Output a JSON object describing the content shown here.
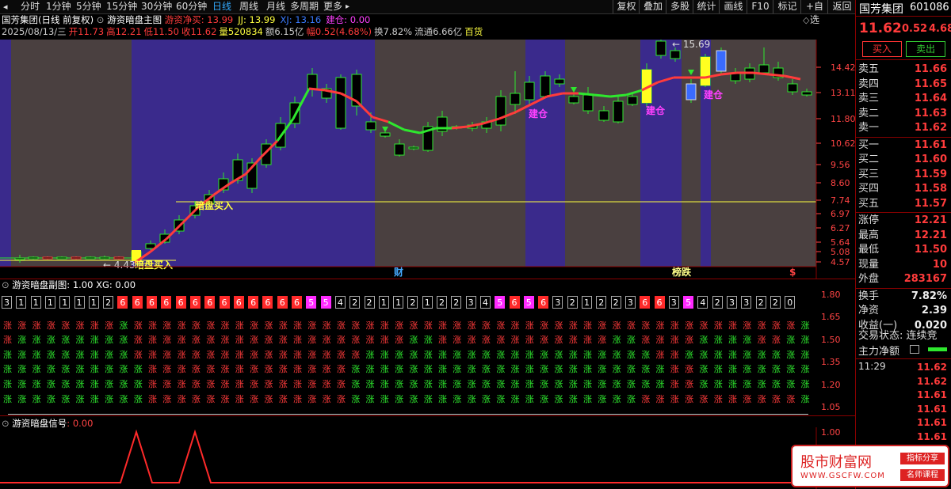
{
  "toolbar": {
    "tabs": [
      "分时",
      "1分钟",
      "5分钟",
      "15分钟",
      "30分钟",
      "60分钟",
      "日线",
      "周线",
      "月线",
      "多周期",
      "更多"
    ],
    "active": "日线",
    "right_buttons": [
      "复权",
      "叠加",
      "多股",
      "统计",
      "画线",
      "F10",
      "标记",
      "+自选",
      "返回"
    ]
  },
  "header": {
    "stock_name": "国芳集团",
    "mode": "(日线 前复权)",
    "indicator": "游资暗盘主图",
    "ind_vals": [
      {
        "label": "游资净买: 13.99",
        "color": "#ff3b3b"
      },
      {
        "label": "JJ: 13.99",
        "color": "#ffff40"
      },
      {
        "label": "XJ: 13.16",
        "color": "#3a7bff"
      },
      {
        "label": "建仓: 0.00",
        "color": "#ff40ff"
      }
    ],
    "line2": [
      {
        "t": "2025/08/13/三",
        "c": "#ccc"
      },
      {
        "t": "开11.73",
        "c": "#ff3b3b"
      },
      {
        "t": "高12.21",
        "c": "#ff3b3b"
      },
      {
        "t": "低11.50",
        "c": "#ff3b3b"
      },
      {
        "t": "收11.62",
        "c": "#ff3b3b"
      },
      {
        "t": "量520834",
        "c": "#ffff40"
      },
      {
        "t": "额6.15亿",
        "c": "#ccc"
      },
      {
        "t": "幅0.52(4.68%)",
        "c": "#ff3b3b"
      },
      {
        "t": "换7.82%",
        "c": "#ccc"
      },
      {
        "t": "流通6.66亿",
        "c": "#ccc"
      },
      {
        "t": "百货",
        "c": "#ffff40"
      }
    ]
  },
  "main_chart": {
    "annotations": [
      {
        "text": "暗盘买入",
        "color": "#ffff40"
      },
      {
        "text": "暗盘买入",
        "color": "#ffff40"
      },
      {
        "text": "建仓",
        "color": "#ff40ff"
      },
      {
        "text": "建仓",
        "color": "#ff40ff"
      },
      {
        "text": "建仓",
        "color": "#ff40ff"
      },
      {
        "text": "15.69",
        "color": "#ddd"
      },
      {
        "text": "4.43",
        "color": "#ddd"
      },
      {
        "text": "财",
        "color": "#4af"
      },
      {
        "text": "榜跌",
        "color": "#ff8"
      },
      {
        "text": "$",
        "color": "#f44"
      }
    ],
    "price_axis": [
      "14.42",
      "13.11",
      "11.80",
      "10.62",
      "9.56",
      "8.60",
      "7.74",
      "6.97",
      "6.27",
      "5.64",
      "5.08",
      "4.57"
    ]
  },
  "sub1": {
    "title": "游资暗盘副图",
    "value": ": 1.00",
    "xg": "XG: 0.00",
    "boxes": [
      "3",
      "1",
      "1",
      "1",
      "1",
      "1",
      "1",
      "2",
      "6",
      "6",
      "6",
      "6",
      "6",
      "6",
      "6",
      "6",
      "6",
      "6",
      "6",
      "6",
      "6",
      "5",
      "5",
      "4",
      "2",
      "2",
      "1",
      "1",
      "2",
      "1",
      "2",
      "2",
      "3",
      "4",
      "5",
      "6",
      "5",
      "6",
      "3",
      "2",
      "1",
      "2",
      "2",
      "3",
      "6",
      "6",
      "3",
      "5",
      "4",
      "2",
      "3",
      "3",
      "2",
      "2",
      "0"
    ],
    "axis": [
      "1.80",
      "1.65",
      "1.50",
      "1.35",
      "1.20",
      "1.05"
    ],
    "zhang_char": "涨"
  },
  "sub2": {
    "title": "游资暗盘信号",
    "value": ": 0.00",
    "axis": [
      "1.00"
    ]
  },
  "quote": {
    "name": "国芳集团",
    "code": "601086",
    "price": "11.62",
    "change": "0.52",
    "pct": "4.68",
    "buy_btn": "买入",
    "sell_btn": "卖出",
    "asks": [
      {
        "label": "卖五",
        "val": "11.66"
      },
      {
        "label": "卖四",
        "val": "11.65"
      },
      {
        "label": "卖三",
        "val": "11.64"
      },
      {
        "label": "卖二",
        "val": "11.63"
      },
      {
        "label": "卖一",
        "val": "11.62"
      }
    ],
    "bids": [
      {
        "label": "买一",
        "val": "11.61"
      },
      {
        "label": "买二",
        "val": "11.60"
      },
      {
        "label": "买三",
        "val": "11.59"
      },
      {
        "label": "买四",
        "val": "11.58"
      },
      {
        "label": "买五",
        "val": "11.57"
      }
    ],
    "stats": [
      {
        "label": "涨停",
        "val": "12.21"
      },
      {
        "label": "最高",
        "val": "12.21"
      },
      {
        "label": "最低",
        "val": "11.50"
      },
      {
        "label": "现量",
        "val": "10"
      },
      {
        "label": "外盘",
        "val": "283167"
      }
    ],
    "stats2": [
      {
        "label": "换手",
        "val": "7.82%"
      },
      {
        "label": "净资",
        "val": "2.39"
      },
      {
        "label": "收益(一)",
        "val": "0.020"
      }
    ],
    "trade_status": "交易状态: 连续竞",
    "main_net": "主力净额",
    "ticks_time": "11:29",
    "ticks": [
      "11.62",
      "11.62",
      "11.61",
      "11.61",
      "11.61",
      "11.61"
    ]
  },
  "watermark": {
    "title": "股市财富网",
    "url": "WWW.GSCFW.COM",
    "tag1": "指标分享",
    "tag2": "名师课程"
  }
}
